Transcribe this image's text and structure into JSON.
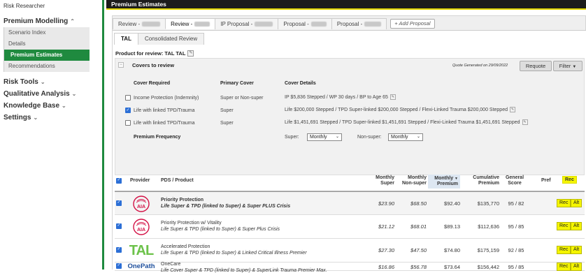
{
  "sidebar": {
    "top_label": "Risk Researcher",
    "premium_modelling": {
      "label": "Premium Modelling",
      "items": [
        "Scenario Index",
        "Details",
        "Premium Estimates",
        "Recommendations"
      ]
    },
    "risk_tools": "Risk Tools",
    "qualitative_analysis": "Qualitative Analysis",
    "knowledge_base": "Knowledge Base",
    "settings": "Settings"
  },
  "header": {
    "title": "Premium Estimates"
  },
  "proposal_tabs": [
    {
      "label": "Review -"
    },
    {
      "label": "Review -"
    },
    {
      "label": "IP Proposal -"
    },
    {
      "label": "Proposal -"
    },
    {
      "label": "Proposal -"
    }
  ],
  "add_proposal": "+ Add Proposal",
  "sub_tabs": {
    "tal": "TAL",
    "consolidated": "Consolidated Review"
  },
  "product_for_review": "Product for review: TAL TAL",
  "covers": {
    "title": "Covers to review",
    "quote_generated": "Quote Generated on 29/09/2022",
    "requote": "Requote",
    "filter": "Filter",
    "headers": {
      "required": "Cover Required",
      "primary": "Primary Cover",
      "details": "Cover Details"
    },
    "rows": [
      {
        "required": "Income Protection (Indemnity)",
        "primary": "Super or Non-super",
        "details": "IP $5,836 Stepped / WP 30 days / BP to Age 65",
        "checked": false
      },
      {
        "required": "Life with linked TPD/Trauma",
        "primary": "Super",
        "details": "Life $200,000 Stepped / TPD Super-linked $200,000 Stepped / Flexi-Linked Trauma $200,000 Stepped",
        "checked": true
      },
      {
        "required": "Life with linked TPD/Trauma",
        "primary": "Super",
        "details": "Life $1,451,691 Stepped / TPD Super-linked $1,451,691 Stepped / Flexi-Linked Trauma $1,451,691 Stepped",
        "checked": false
      }
    ],
    "premium_frequency": "Premium Frequency",
    "super_label": "Super:",
    "super_value": "Monthly",
    "nonsuper_label": "Non-super:",
    "nonsuper_value": "Monthly"
  },
  "table": {
    "headers": {
      "provider": "Provider",
      "pds": "PDS / Product",
      "monthly": "Monthly",
      "super": "Super",
      "nonsuper": "Non-super",
      "premium": "Premium",
      "cumulative": "Cumulative",
      "general": "General",
      "score": "Score",
      "pref": "Pref",
      "rec": "Rec"
    },
    "rows": [
      {
        "provider": "AIA",
        "name": "Priority Protection",
        "desc": "Life Super & TPD (linked to Super) & Super PLUS Crisis",
        "super": "$23.90",
        "nonsuper": "$68.50",
        "premium": "$92.40",
        "cumulative": "$135,770",
        "score": "95 / 82",
        "rec": "Rec",
        "alt": "Alt"
      },
      {
        "provider": "AIA",
        "name": "Priority Protection w/ Vitality",
        "desc": "Life Super & TPD (linked to Super) & Super Plus Crisis",
        "super": "$21.12",
        "nonsuper": "$68.01",
        "premium": "$89.13",
        "cumulative": "$112,636",
        "score": "95 / 85",
        "rec": "Rec",
        "alt": "Alt"
      },
      {
        "provider": "TAL",
        "name": "Accelerated Protection",
        "desc": "Life Super & TPD (linked to Super) & Linked Critical Illness Premier",
        "super": "$27.30",
        "nonsuper": "$47.50",
        "premium": "$74.80",
        "cumulative": "$175,159",
        "score": "92 / 85",
        "rec": "Rec",
        "alt": "Alt"
      },
      {
        "provider": "OnePath",
        "name": "OneCare",
        "desc": "Life Cover Super & TPD (linked to Super) & SuperLink Trauma Premier Max.",
        "super": "$16.86",
        "nonsuper": "$56.78",
        "premium": "$73.64",
        "cumulative": "$156,442",
        "score": "95 / 85",
        "rec": "Rec",
        "alt": "Alt"
      }
    ]
  },
  "colors": {
    "green": "#1f8a3f",
    "yellow": "#f5f500",
    "blue": "#2c6fd6",
    "aia_red": "#d31145",
    "tal_green": "#6cc24a",
    "onepath_blue": "#1e4f9c"
  }
}
